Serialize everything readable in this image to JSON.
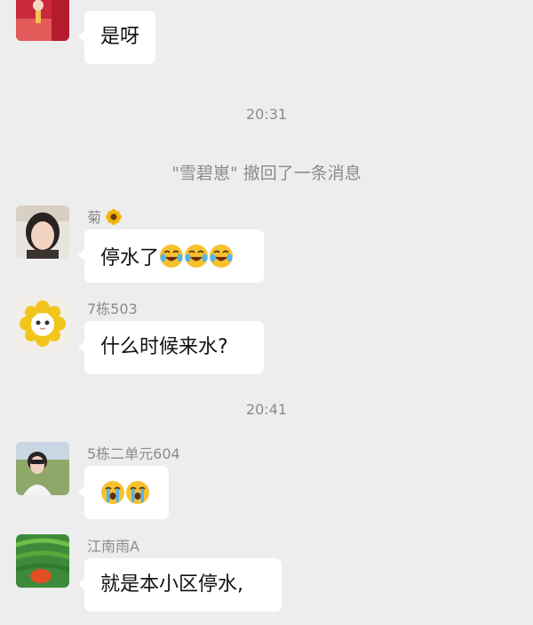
{
  "messages": [
    {
      "sender": "",
      "text": "是呀"
    },
    {
      "sender": "菊",
      "sender_icon": "sunflower-emoji",
      "text": "停水了",
      "emojis": [
        "crying-laughing-emoji",
        "crying-laughing-emoji",
        "crying-laughing-emoji"
      ]
    },
    {
      "sender": "7栋503",
      "text": "什么时候来水?"
    },
    {
      "sender": "5栋二单元604",
      "text": "",
      "emojis": [
        "loudly-crying-emoji",
        "loudly-crying-emoji"
      ]
    },
    {
      "sender": "江南雨A",
      "text": "就是本小区停水,"
    }
  ],
  "timestamps": [
    "20:31",
    "20:41"
  ],
  "system_notice": "\"雪碧崽\" 撤回了一条消息",
  "colors": {
    "background": "#ededed",
    "bubble": "#ffffff",
    "meta_text": "#8b8b8b"
  }
}
